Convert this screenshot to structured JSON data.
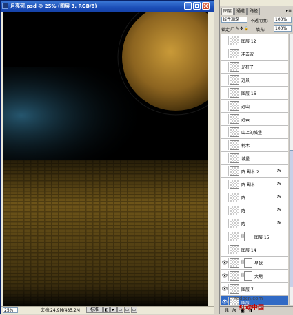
{
  "window": {
    "title": "月亮河.psd @ 25% (图层 3, RGB/8)",
    "zoom": "25%",
    "doc_info": "文档:24.9M/485.2M",
    "status_buttons": [
      "标准"
    ]
  },
  "panel": {
    "tabs": [
      "图层",
      "通道",
      "路径"
    ],
    "blend_mode": "线性加深",
    "opacity_label": "不透明度:",
    "opacity_value": "100%",
    "lock_label": "锁定:",
    "fill_label": "填充:",
    "fill_value": "100%",
    "layers": [
      {
        "name": "图层 12",
        "visible": false,
        "fx": false
      },
      {
        "name": "冲击波",
        "visible": false,
        "fx": false
      },
      {
        "name": "光柱子",
        "visible": false,
        "fx": false
      },
      {
        "name": "远景",
        "visible": false,
        "fx": false
      },
      {
        "name": "图层 16",
        "visible": false,
        "fx": false
      },
      {
        "name": "远山",
        "visible": false,
        "fx": false
      },
      {
        "name": "远云",
        "visible": false,
        "fx": false
      },
      {
        "name": "山上的城堡",
        "visible": false,
        "fx": false
      },
      {
        "name": "树木",
        "visible": false,
        "fx": false
      },
      {
        "name": "城堡",
        "visible": false,
        "fx": false
      },
      {
        "name": "阵 副本 2",
        "visible": false,
        "fx": true
      },
      {
        "name": "阵 副本",
        "visible": false,
        "fx": true
      },
      {
        "name": "阵",
        "visible": false,
        "fx": true
      },
      {
        "name": "阵",
        "visible": false,
        "fx": true
      },
      {
        "name": "阵",
        "visible": false,
        "fx": true
      },
      {
        "name": "图层 15",
        "visible": false,
        "fx": false,
        "mask": true
      },
      {
        "name": "图层 14",
        "visible": false,
        "fx": false
      },
      {
        "name": "星球",
        "visible": true,
        "fx": false,
        "mask": true
      },
      {
        "name": "大地",
        "visible": true,
        "fx": false,
        "mask": true
      },
      {
        "name": "图层 7",
        "visible": true,
        "fx": false
      },
      {
        "name": "图层",
        "visible": true,
        "fx": false,
        "selected": true
      }
    ],
    "fx_label": "fx"
  },
  "watermark": {
    "url": "redocn.com",
    "text": "红动中国"
  },
  "colors": {
    "selection": "#316ac5",
    "titlebar": "#1c4fb8",
    "moon": "#b8862a",
    "ground": "#6a5418"
  }
}
